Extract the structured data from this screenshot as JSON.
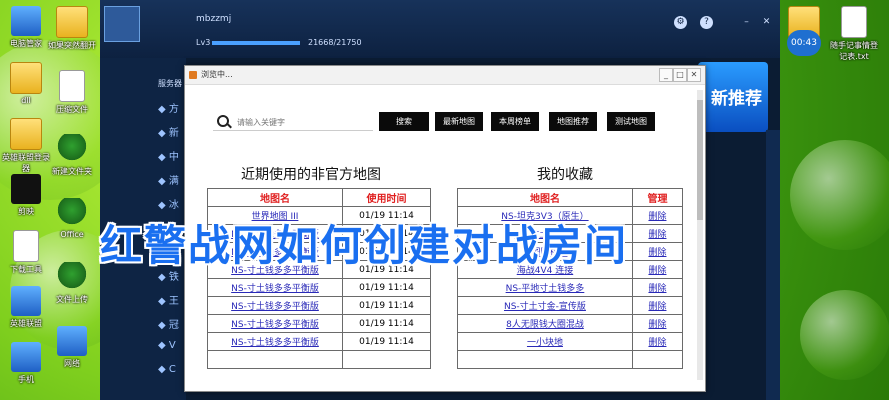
{
  "desktop": {
    "icons_left": [
      {
        "label": "电脑管家",
        "type": "blue"
      },
      {
        "label": "dll",
        "type": "folder"
      },
      {
        "label": "英雄联盟登录器",
        "type": "folder"
      },
      {
        "label": "剪映",
        "type": "dark"
      },
      {
        "label": "下载工具",
        "type": "doc"
      },
      {
        "label": "英雄联盟",
        "type": "blue"
      },
      {
        "label": "手机",
        "type": "blue"
      }
    ],
    "icons_col2": [
      {
        "label": "如果突然翻开",
        "type": "folder"
      },
      {
        "label": "压缩文件",
        "type": "doc"
      },
      {
        "label": "新建文件夹",
        "type": "tree"
      },
      {
        "label": "Office",
        "type": "tree"
      },
      {
        "label": "文件上传",
        "type": "tree"
      },
      {
        "label": "网络",
        "type": "blue"
      }
    ],
    "icons_right": [
      {
        "label": "软件",
        "type": "folder"
      },
      {
        "label": "随手记事情登记表.txt",
        "type": "doc"
      }
    ],
    "clock": "00:43"
  },
  "client": {
    "username": "mbzzmj",
    "level": "Lv3",
    "exp_text": "21668/21750",
    "exp_progress": 0.996,
    "side_title": "服务器",
    "banner_text": "新推荐",
    "side_items": [
      "方",
      "新",
      "中",
      "满",
      "冰",
      "冰",
      "竞",
      "铁",
      "王",
      "冠",
      "V",
      "C"
    ]
  },
  "dialog": {
    "title": "浏览中...",
    "search_placeholder": "请输入关键字",
    "buttons": {
      "search": "搜索",
      "latest": "最新地图",
      "weekly": "本周榜单",
      "recommend": "地图推荐",
      "test": "测试地图"
    },
    "recent": {
      "title": "近期使用的非官方地图",
      "headers": [
        "地图名",
        "使用时间"
      ],
      "rows": [
        [
          "世界地图 III",
          "01/19 11:14"
        ],
        [
          "NS-寸土钱多多平衡版",
          "01/19 11:14"
        ],
        [
          "NS-寸土钱多多平衡版",
          "01/19 11:14"
        ],
        [
          "NS-寸土钱多多平衡版",
          "01/19 11:14"
        ],
        [
          "NS-寸土钱多多平衡版",
          "01/19 11:14"
        ],
        [
          "NS-寸土钱多多平衡版",
          "01/19 11:14"
        ],
        [
          "NS-寸土钱多多平衡版",
          "01/19 11:14"
        ],
        [
          "NS-寸土钱多多平衡版",
          "01/19 11:14"
        ],
        [
          "",
          ""
        ]
      ]
    },
    "favorites": {
      "title": "我的收藏",
      "headers": [
        "地图名",
        "管理"
      ],
      "rows": [
        [
          "NS-坦克3V3（原生）",
          "删除"
        ],
        [
          "NS-寸土钱多多",
          "删除"
        ],
        [
          "全图随机战",
          "删除"
        ],
        [
          "海战4V4 连接",
          "删除"
        ],
        [
          "NS-平地寸土钱多多",
          "删除"
        ],
        [
          "NS-寸土寸金-宣传版",
          "删除"
        ],
        [
          "8人无限钱大圈混战",
          "删除"
        ],
        [
          "一小块地",
          "删除"
        ],
        [
          "",
          ""
        ]
      ]
    }
  },
  "overlay_title": "红警战网如何创建对战房间",
  "colors": {
    "overlay": "#1a6ff0",
    "header_red": "#e02020",
    "link": "#2a2ab8",
    "button_bg": "#0a0a0a"
  }
}
